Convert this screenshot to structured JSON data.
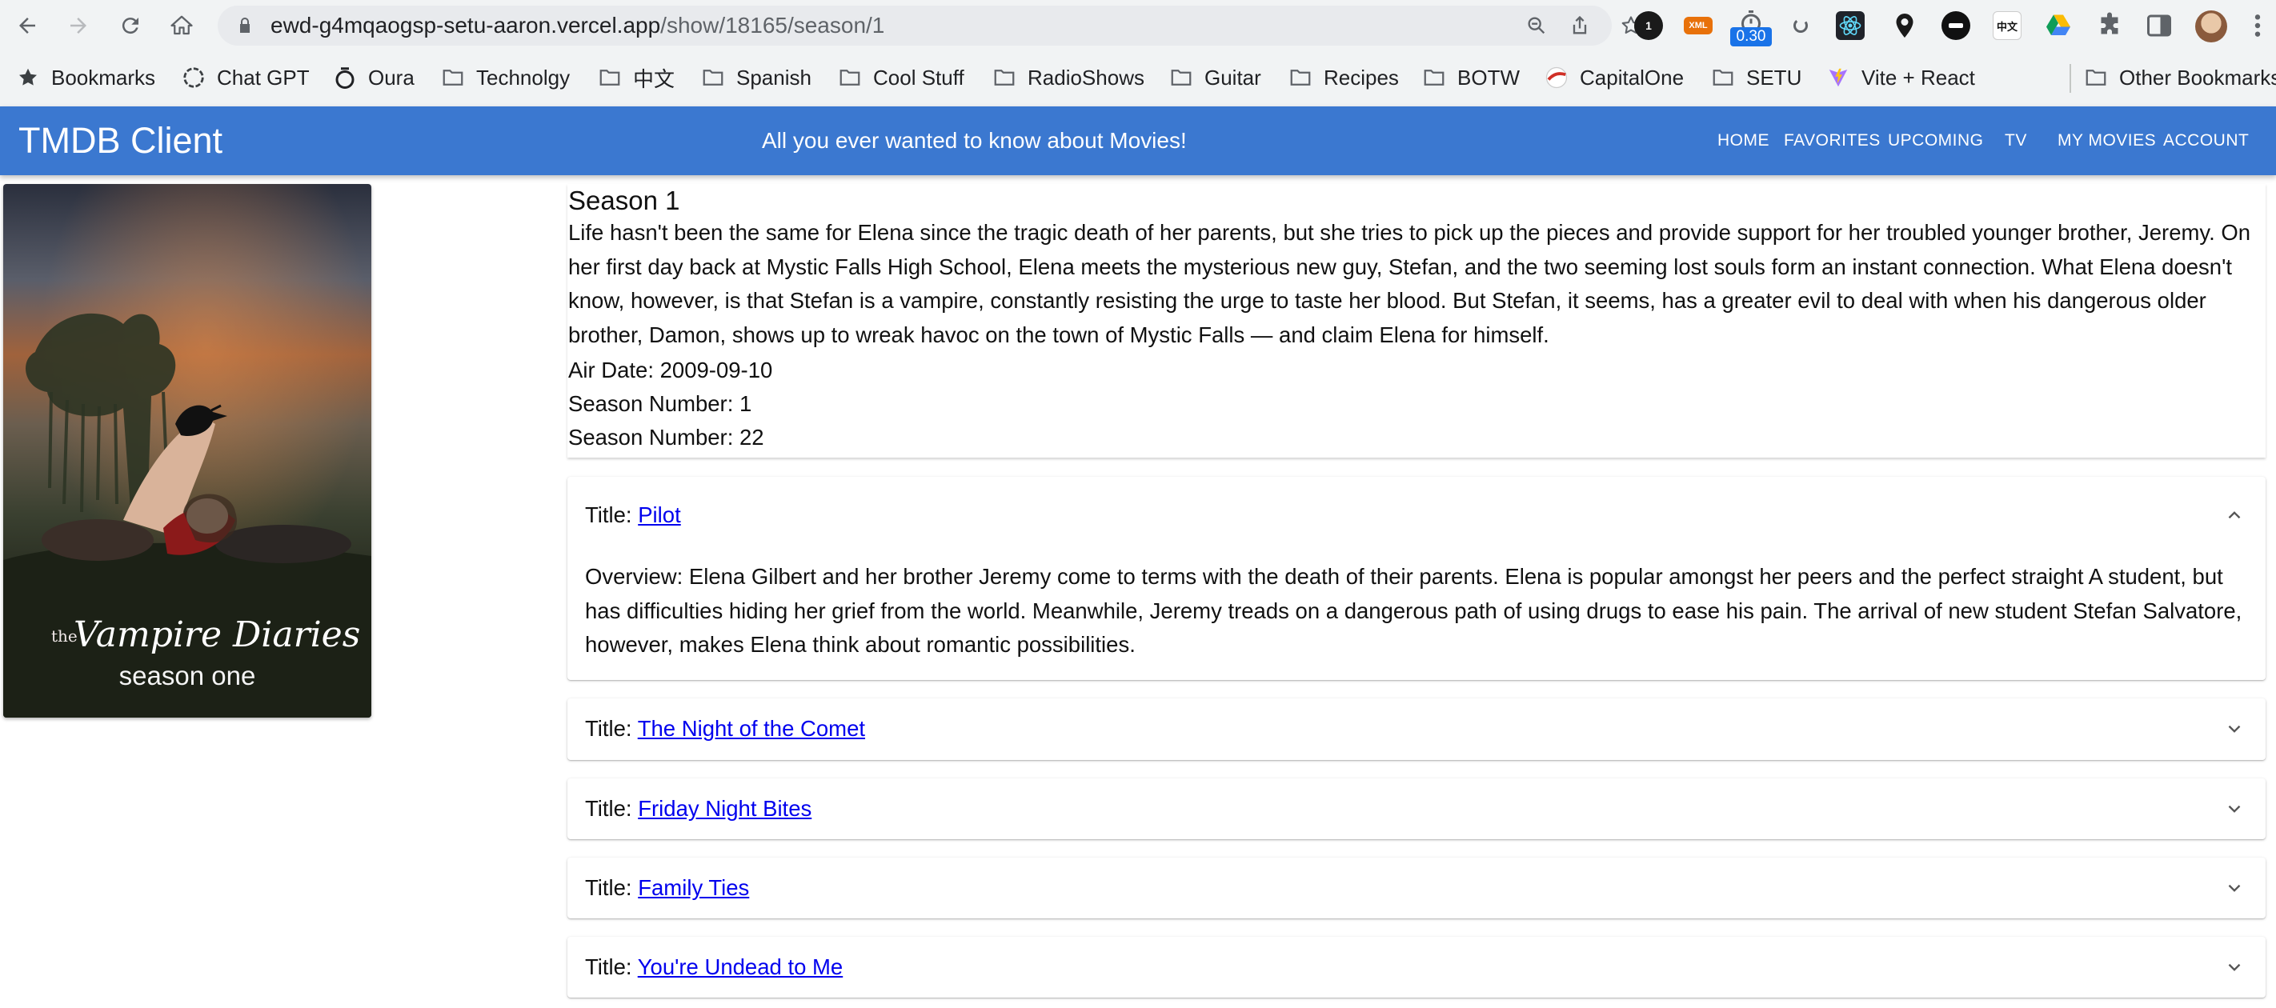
{
  "browser": {
    "url_host": "ewd-g4mqaogsp-setu-aaron.vercel.app",
    "url_path": "/show/18165/season/1",
    "extension_badge": "0.30",
    "extension_icons": [
      "1password-icon",
      "xml-viewer-icon",
      "timer-extension-icon",
      "spinner-extension-icon",
      "react-devtools-icon",
      "location-pin-icon",
      "circle-minus-extension-icon",
      "chinese-dictionary-icon",
      "google-drive-icon",
      "extensions-puzzle-icon",
      "side-panel-icon"
    ],
    "ext_xml_label": "XML",
    "ext_chinese_label": "中文",
    "bookmarks": [
      {
        "label": "Bookmarks",
        "icon": "star-icon"
      },
      {
        "label": "Chat GPT",
        "icon": "openai-icon"
      },
      {
        "label": "Oura",
        "icon": "oura-ring-icon"
      },
      {
        "label": "Technolgy",
        "icon": "folder-icon"
      },
      {
        "label": "中文",
        "icon": "folder-icon"
      },
      {
        "label": "Spanish",
        "icon": "folder-icon"
      },
      {
        "label": "Cool Stuff",
        "icon": "folder-icon"
      },
      {
        "label": "RadioShows",
        "icon": "folder-icon"
      },
      {
        "label": "Guitar",
        "icon": "folder-icon"
      },
      {
        "label": "Recipes",
        "icon": "folder-icon"
      },
      {
        "label": "BOTW",
        "icon": "folder-icon"
      },
      {
        "label": "CapitalOne",
        "icon": "capitalone-icon"
      },
      {
        "label": "SETU",
        "icon": "folder-icon"
      },
      {
        "label": "Vite + React",
        "icon": "vite-icon"
      },
      {
        "label": "Other Bookmarks",
        "icon": "folder-icon"
      }
    ]
  },
  "app": {
    "brand": "TMDB Client",
    "tagline": "All you ever wanted to know about Movies!",
    "nav": [
      "Home",
      "Favorites",
      "Upcoming",
      "TV",
      "My Movies",
      "Account"
    ]
  },
  "poster": {
    "title_small": "the",
    "title_main": "Vampire Diaries",
    "subtitle": "season one"
  },
  "season": {
    "title": "Season 1",
    "overview": "Life hasn't been the same for Elena since the tragic death of her parents, but she tries to pick up the pieces and provide support for her troubled younger brother, Jeremy. On her first day back at Mystic Falls High School, Elena meets the mysterious new guy, Stefan, and the two seeming lost souls form an instant connection. What Elena doesn't know, however, is that Stefan is a vampire, constantly resisting the urge to taste her blood. But Stefan, it seems, has a greater evil to deal with when his dangerous older brother, Damon, shows up to wreak havoc on the town of Mystic Falls — and claim Elena for himself.",
    "air_date": "Air Date: 2009-09-10",
    "season_number": "Season Number: 1",
    "episode_count": "Season Number: 22"
  },
  "episodes": [
    {
      "title_prefix": "Title: ",
      "title": "Pilot",
      "expanded": true,
      "overview": "Overview: Elena Gilbert and her brother Jeremy come to terms with the death of their parents. Elena is popular amongst her peers and the perfect straight A student, but has difficulties hiding her grief from the world. Meanwhile, Jeremy treads on a dangerous path of using drugs to ease his pain. The arrival of new student Stefan Salvatore, however, makes Elena think about romantic possibilities."
    },
    {
      "title_prefix": "Title: ",
      "title": "The Night of the Comet",
      "expanded": false
    },
    {
      "title_prefix": "Title: ",
      "title": "Friday Night Bites",
      "expanded": false
    },
    {
      "title_prefix": "Title: ",
      "title": "Family Ties",
      "expanded": false
    },
    {
      "title_prefix": "Title: ",
      "title": "You're Undead to Me",
      "expanded": false
    }
  ],
  "colors": {
    "app_bar": "#3b78d0",
    "link": "#0000ee",
    "chrome_bg": "#f1f3f4"
  }
}
